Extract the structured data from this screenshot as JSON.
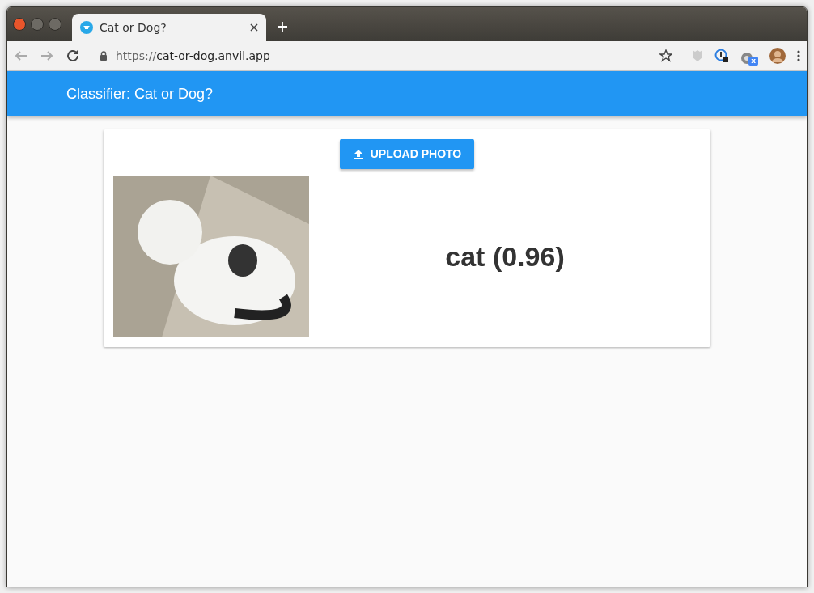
{
  "browser": {
    "tabs": [
      {
        "title": "Cat or Dog?",
        "selected": true
      }
    ],
    "url_scheme": "https://",
    "url_host": "cat-or-dog.anvil.app",
    "extension_badge": "x"
  },
  "app": {
    "title": "Classifier: Cat or Dog?",
    "upload_button": "UPLOAD PHOTO",
    "result": "cat (0.96)"
  }
}
